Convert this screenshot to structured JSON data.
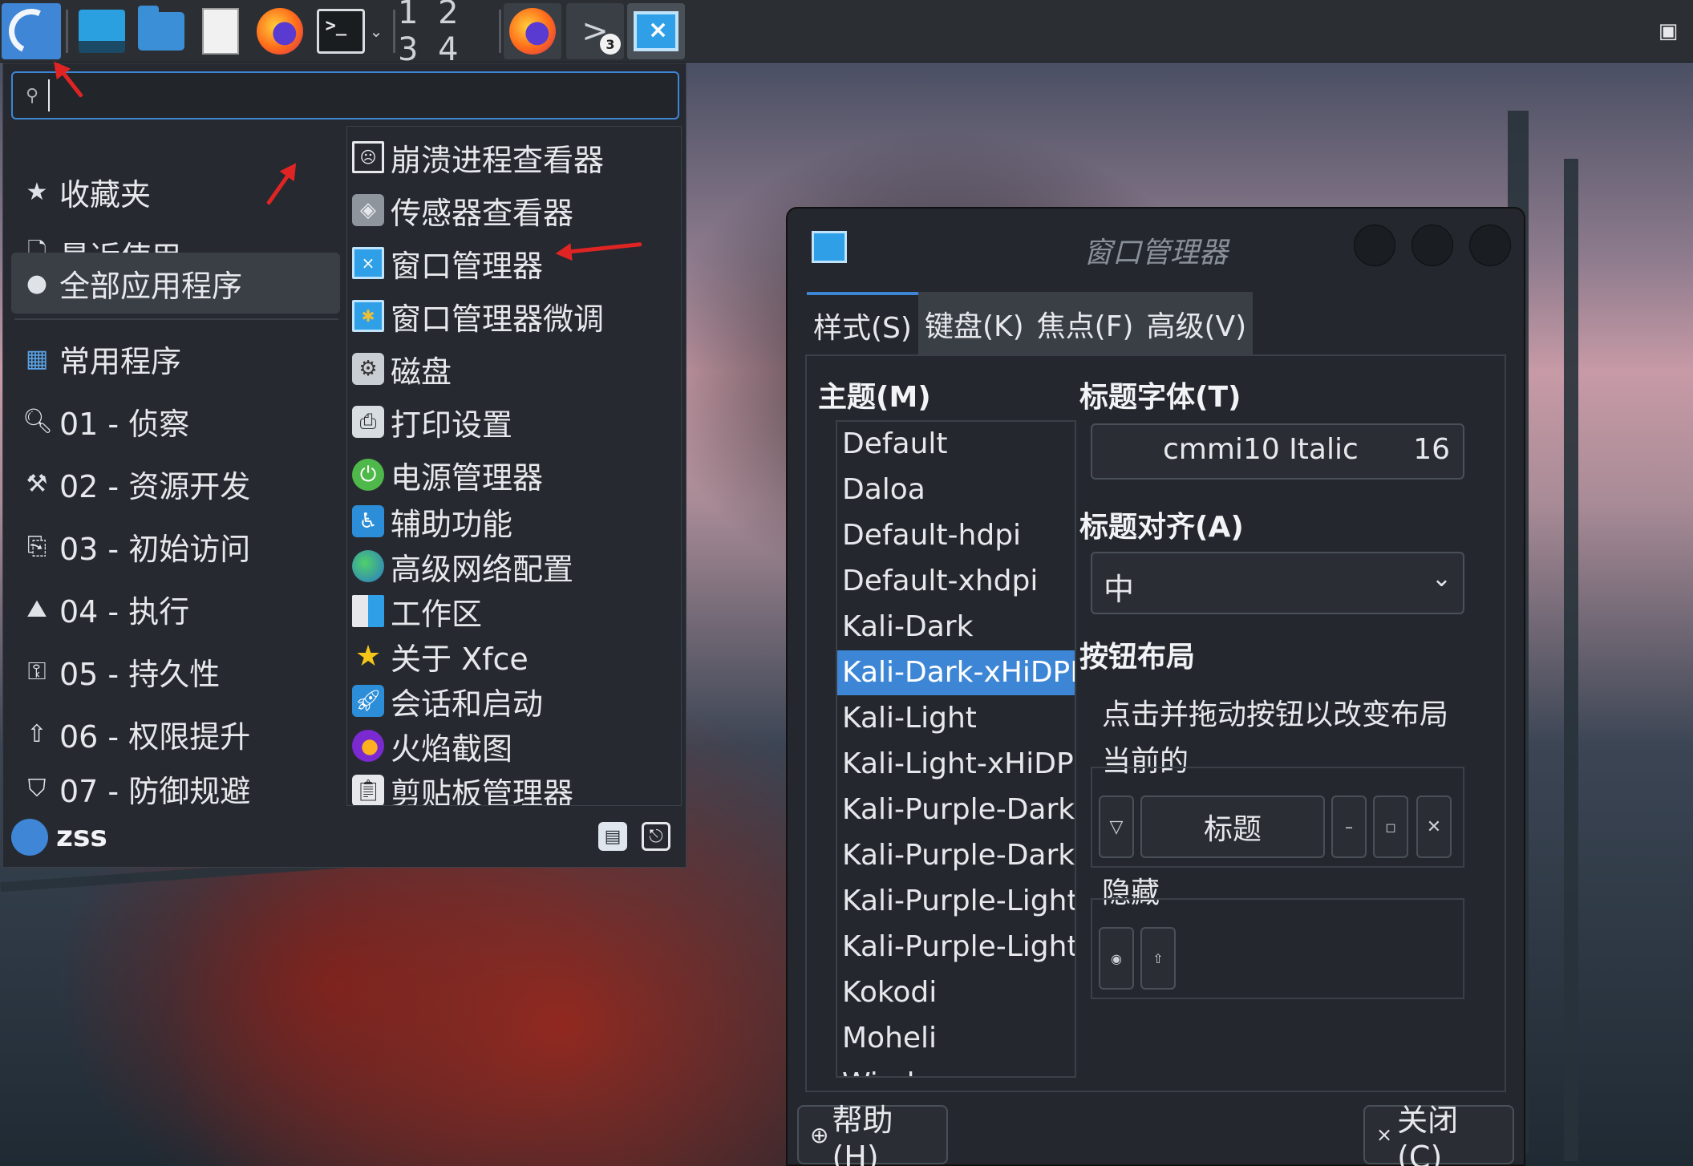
{
  "panel": {
    "workspaces": "1 2 3 4",
    "terminal_badge": "3",
    "icons": [
      "kali-menu-icon",
      "show-desktop-icon",
      "file-manager-icon",
      "text-editor-icon",
      "firefox-icon",
      "terminal-icon",
      "workspace-switcher",
      "firefox-window-icon",
      "terminal-window-icon",
      "window-manager-window-icon",
      "notification-icon"
    ]
  },
  "app_menu": {
    "search": {
      "value": "",
      "placeholder": ""
    },
    "categories": [
      {
        "label": "收藏夹",
        "icon": "star-icon"
      },
      {
        "label": "最近使用",
        "icon": "recent-document-icon"
      },
      {
        "label": "全部应用程序",
        "icon": "more-apps-icon"
      },
      {
        "label": "常用程序",
        "icon": "grid-icon"
      },
      {
        "label": "01 - 侦察",
        "icon": "magnifier-icon"
      },
      {
        "label": "02 - 资源开发",
        "icon": "hammer-icon"
      },
      {
        "label": "03 - 初始访问",
        "icon": "access-icon"
      },
      {
        "label": "04 - 执行",
        "icon": "execute-icon"
      },
      {
        "label": "05 - 持久性",
        "icon": "persistence-icon"
      },
      {
        "label": "06 - 权限提升",
        "icon": "arrow-up-icon"
      },
      {
        "label": "07 - 防御规避",
        "icon": "shield-icon"
      }
    ],
    "active_category": "全部应用程序",
    "apps": [
      {
        "label": "崩溃进程查看器",
        "icon": "crash-viewer-icon"
      },
      {
        "label": "传感器查看器",
        "icon": "sensor-viewer-icon"
      },
      {
        "label": "窗口管理器",
        "icon": "window-manager-icon"
      },
      {
        "label": "窗口管理器微调",
        "icon": "window-manager-tweaks-icon"
      },
      {
        "label": "磁盘",
        "icon": "disk-icon"
      },
      {
        "label": "打印设置",
        "icon": "printer-icon"
      },
      {
        "label": "电源管理器",
        "icon": "power-manager-icon"
      },
      {
        "label": "辅助功能",
        "icon": "accessibility-icon"
      },
      {
        "label": "高级网络配置",
        "icon": "network-globe-icon"
      },
      {
        "label": "工作区",
        "icon": "workspaces-icon"
      },
      {
        "label": "关于 Xfce",
        "icon": "about-xfce-icon"
      },
      {
        "label": "会话和启动",
        "icon": "session-rocket-icon"
      },
      {
        "label": "火焰截图",
        "icon": "flameshot-icon"
      },
      {
        "label": "剪贴板管理器",
        "icon": "clipboard-icon"
      }
    ],
    "user": "zss"
  },
  "wm_dialog": {
    "title": "窗口管理器",
    "tabs": [
      "样式(S)",
      "键盘(K)",
      "焦点(F)",
      "高级(V)"
    ],
    "active_tab": "样式(S)",
    "theme_label": "主题(M)",
    "themes": [
      "Default",
      "Daloa",
      "Default-hdpi",
      "Default-xhdpi",
      "Kali-Dark",
      "Kali-Dark-xHiDPI",
      "Kali-Light",
      "Kali-Light-xHiDPI",
      "Kali-Purple-Dark",
      "Kali-Purple-Dark-",
      "Kali-Purple-Light",
      "Kali-Purple-Light",
      "Kokodi",
      "Moheli",
      "Wind..."
    ],
    "selected_theme": "Kali-Dark-xHiDPI",
    "title_font_label": "标题字体(T)",
    "title_font": {
      "name": "cmmi10 Italic",
      "size": "16"
    },
    "title_align_label": "标题对齐(A)",
    "title_align_value": "中",
    "button_layout_label": "按钮布局",
    "button_layout_hint": "点击并拖动按钮以改变布局",
    "current_label": "当前的",
    "current_title_button": "标题",
    "hidden_label": "隐藏",
    "help_button": "帮助(H)",
    "close_button": "关闭(C)"
  },
  "colors": {
    "accent": "#3d86d6",
    "annotation": "#e02424",
    "panel_bg": "#2b2f34",
    "menu_bg": "#262a30"
  }
}
